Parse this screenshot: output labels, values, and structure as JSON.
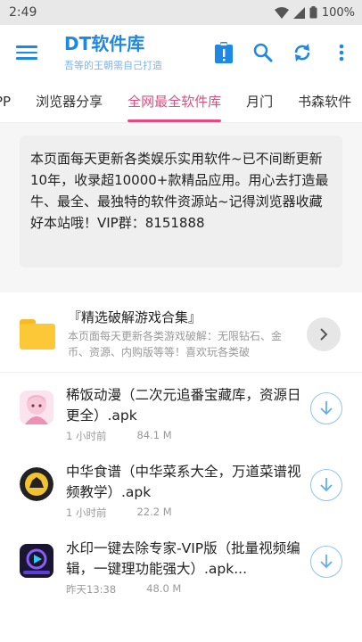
{
  "status": {
    "time": "2:49",
    "battery": "100%"
  },
  "header": {
    "title": "DT软件库",
    "subtitle": "吾等的王朝需自己打造",
    "icons": [
      "menu-icon",
      "clipboard-alert-icon",
      "search-icon",
      "refresh-icon",
      "more-vert-icon"
    ]
  },
  "tabs": [
    {
      "label": "PP"
    },
    {
      "label": "浏览器分享"
    },
    {
      "label": "全网最全软件库",
      "active": true
    },
    {
      "label": "月门"
    },
    {
      "label": "书森软件"
    }
  ],
  "notice": {
    "text": "本页面每天更新各类娱乐实用软件~已不间断更新10年，收录超10000+款精品应用。用心去打造最牛、最全、最独特的软件资源站~记得浏览器收藏好本站哦！VIP群：8151888"
  },
  "collection": {
    "title": "『精选破解游戏合集』",
    "desc": "本页面每天更新各类游戏破解：无限钻石、金币、资源、内购版等等！喜欢玩各类破"
  },
  "apps": [
    {
      "name": "稀饭动漫（二次元追番宝藏库，资源日更全）.apk",
      "time": "1 小时前",
      "size": "84.1 M"
    },
    {
      "name": "中华食谱（中华菜系大全，万道菜谱视频教学）.apk",
      "time": "1 小时前",
      "size": "22.2 M"
    },
    {
      "name": "水印一键去除专家-VIP版（批量视频编辑，一键理功能强大）.apk...",
      "time": "昨天13:38",
      "size": "48.0 M"
    }
  ],
  "colors": {
    "accent": "#1e88e5",
    "tab_active": "#e84a7f",
    "folder": "#fcc838"
  }
}
